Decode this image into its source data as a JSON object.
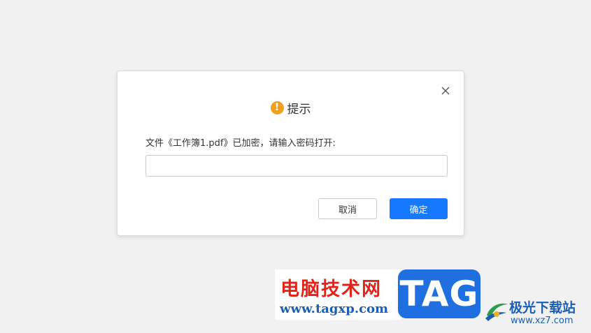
{
  "dialog": {
    "title": "提示",
    "title_icon": "exclamation-circle-icon",
    "message": "文件《工作簿1.pdf》已加密，请输入密码打开:",
    "password_value": "",
    "cancel_label": "取消",
    "ok_label": "确定",
    "close_icon": "close-icon"
  },
  "watermark": {
    "left_cn": "电脑技术网",
    "left_url": "www.tagxp.com",
    "tag_text": "TAG",
    "right_cn": "极光下载站",
    "right_url": "www.xz7.com"
  },
  "colors": {
    "primary": "#1677ff",
    "warning": "#f0a020",
    "watermark_red": "#e2231a",
    "watermark_blue": "#1a5fb4"
  }
}
